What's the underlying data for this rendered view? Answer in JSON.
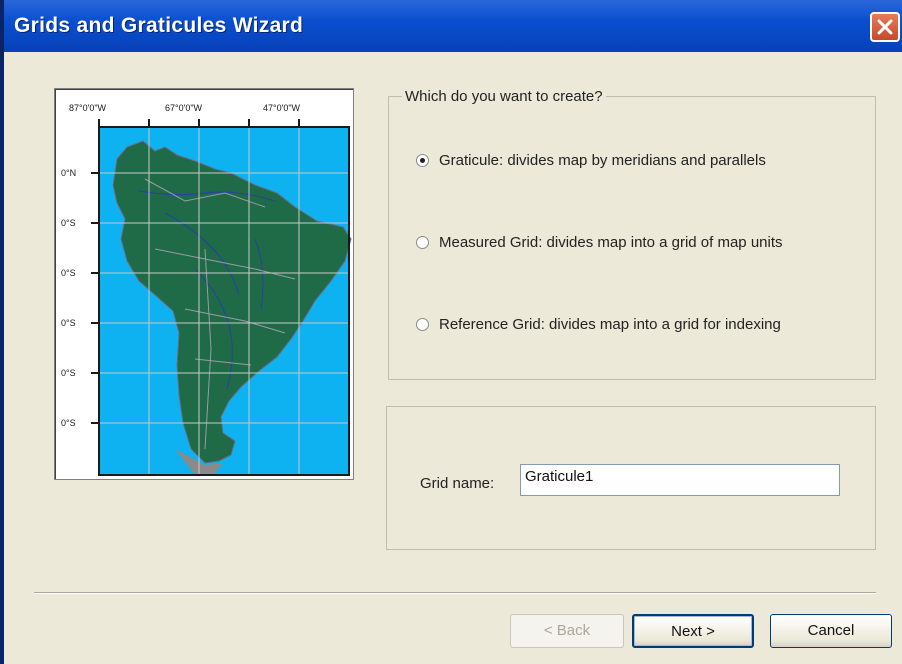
{
  "window": {
    "title": "Grids and Graticules Wizard"
  },
  "map_preview": {
    "top_labels": [
      "87°0'0\"W",
      "67°0'0\"W",
      "47°0'0\"W"
    ],
    "left_labels": [
      "0°N",
      "0°S",
      "0°S",
      "0°S",
      "0°S",
      "0°S"
    ],
    "colors": {
      "ocean": "#0fb2f0",
      "land": "#1f6b47",
      "grid": "#c8c8c8",
      "frame": "#1a1a1a"
    }
  },
  "create_group": {
    "legend": "Which do you want to create?",
    "options": [
      {
        "label": "Graticule: divides map by meridians and parallels",
        "selected": true
      },
      {
        "label": "Measured Grid: divides map into a grid of map units",
        "selected": false
      },
      {
        "label": "Reference Grid: divides map into a grid for indexing",
        "selected": false
      }
    ]
  },
  "name_group": {
    "label": "Grid name:",
    "value": "Graticule1"
  },
  "buttons": {
    "back": "< Back",
    "next": "Next >",
    "cancel": "Cancel"
  }
}
